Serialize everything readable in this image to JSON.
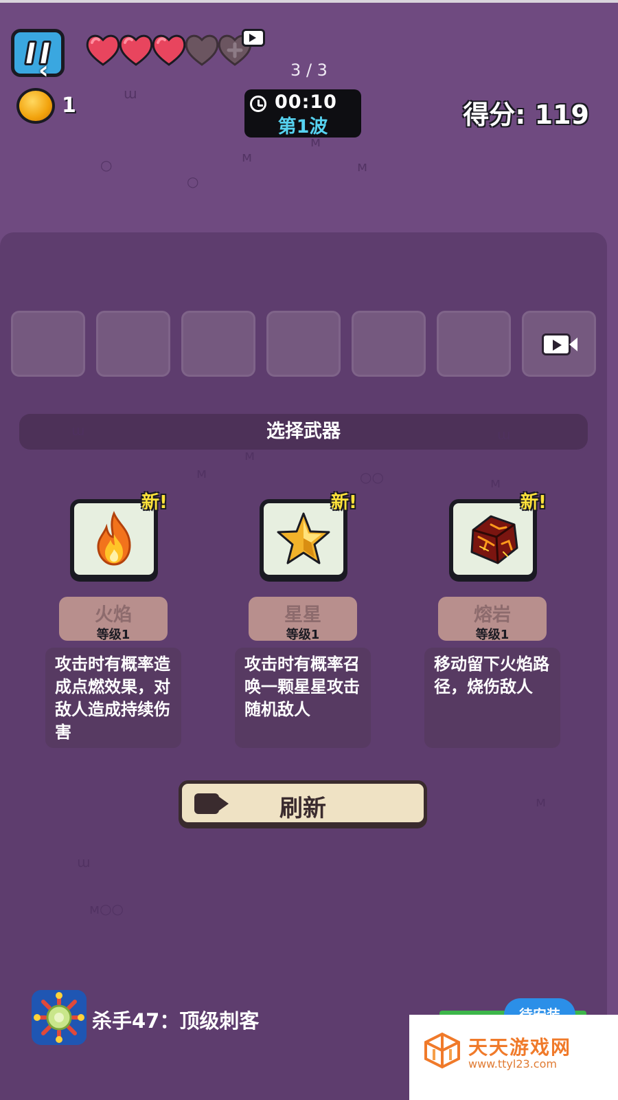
{
  "hud": {
    "pause_icon": "pause-icon",
    "back_icon": "back-chevron-icon",
    "hearts": {
      "filled": 3,
      "empty": 2
    },
    "page_indicator": "3 / 3",
    "coins": "1",
    "timer": "00:10",
    "wave": "第1波",
    "score_label": "得分:",
    "score_value": "119"
  },
  "inventory": {
    "slot_count": 6,
    "ad_slot_icon": "video-camera-icon"
  },
  "choose": {
    "title": "选择武器"
  },
  "weapons": [
    {
      "name": "火焰",
      "level": "等级1",
      "badge": "新!",
      "icon": "fire-icon",
      "description": "攻击时有概率造成点燃效果，对敌人造成持续伤害"
    },
    {
      "name": "星星",
      "level": "等级1",
      "badge": "新!",
      "icon": "star-icon",
      "description": "攻击时有概率召唤一颗星星攻击随机敌人"
    },
    {
      "name": "熔岩",
      "level": "等级1",
      "badge": "新!",
      "icon": "lava-rock-icon",
      "description": "移动留下火焰路径，烧伤敌人"
    }
  ],
  "refresh": {
    "label": "刷新",
    "icon": "video-camera-icon"
  },
  "ad": {
    "title": "杀手47：顶级刺客",
    "install_label": "待安装"
  },
  "watermark": {
    "name": "天天游戏网",
    "url": "www.ttyl23.com"
  },
  "colors": {
    "background": "#6f4a80",
    "panel": "#5e3d6e",
    "accent_blue": "#3aa7e0",
    "wave_text": "#56d2f0",
    "new_badge": "#ffe23a",
    "heart": "#e8455e"
  }
}
